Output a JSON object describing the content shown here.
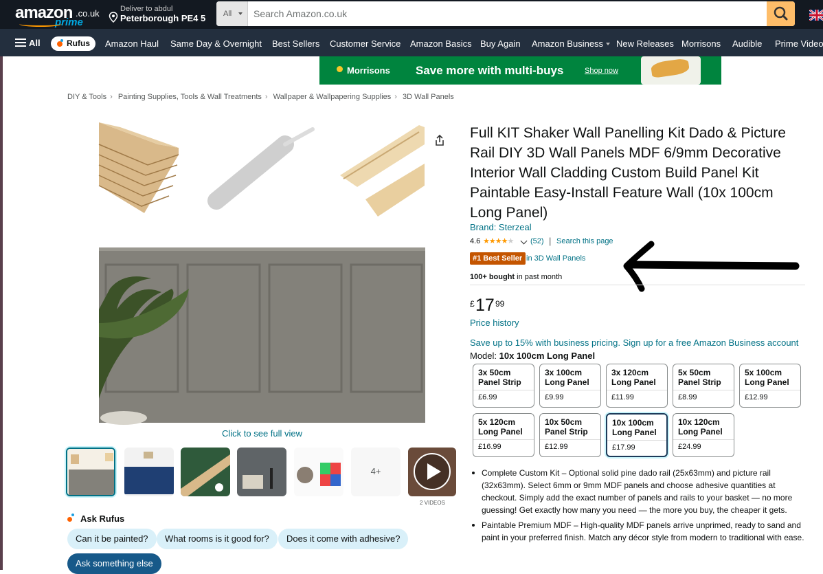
{
  "header": {
    "logo_text": "amazon",
    "logo_cc": ".co.uk",
    "logo_prime": "prime",
    "deliver_line1": "Deliver to abdul",
    "deliver_line2": "Peterborough PE4 5",
    "search_category": "All",
    "search_placeholder": "Search Amazon.co.uk"
  },
  "nav": {
    "all_label": "All",
    "rufus_label": "Rufus",
    "links": [
      "Amazon Haul",
      "Same Day & Overnight",
      "Best Sellers",
      "Customer Service",
      "Amazon Basics",
      "Buy Again",
      "Amazon Business",
      "New Releases",
      "Morrisons",
      "Audible",
      "Prime Video"
    ]
  },
  "banner": {
    "brand": "Morrisons",
    "headline": "Save more with multi-buys",
    "cta": "Shop now"
  },
  "breadcrumbs": [
    "DIY & Tools",
    "Painting Supplies, Tools & Wall Treatments",
    "Wallpaper & Wallpapering Supplies",
    "3D Wall Panels"
  ],
  "gallery": {
    "full_view_label": "Click to see full view",
    "more_label": "4+",
    "videos_label": "2 VIDEOS"
  },
  "rufus": {
    "heading": "Ask Rufus",
    "questions": [
      "Can it be painted?",
      "What rooms is it good for?",
      "Does it come with adhesive?"
    ],
    "ask_button": "Ask something else"
  },
  "product": {
    "title": "Full KIT Shaker Wall Panelling Kit Dado & Picture Rail DIY 3D Wall Panels MDF 6/9mm Decorative Interior Wall Cladding Custom Build Panel Kit Paintable Easy-Install Feature Wall (10x 100cm Long Panel)",
    "brand_link": "Brand: Sterzeal",
    "rating_value": "4.6",
    "rating_stars": 4.6,
    "rating_count": "(52)",
    "search_page": "Search this page",
    "best_seller_badge": "#1 Best Seller",
    "best_seller_category": "in 3D Wall Panels",
    "bought_bold": "100+ bought",
    "bought_rest": " in past month",
    "price_symbol": "£",
    "price_whole": "17",
    "price_fraction": "99",
    "price_history": "Price history",
    "business_line": "Save up to 15% with business pricing. Sign up for a free Amazon Business account",
    "model_label": "Model: ",
    "model_value": "10x 100cm Long Panel"
  },
  "options": [
    {
      "line1": "3x 50cm",
      "line2": "Panel Strip",
      "price": "£6.99"
    },
    {
      "line1": "3x 100cm",
      "line2": "Long Panel",
      "price": "£9.99"
    },
    {
      "line1": "3x 120cm",
      "line2": "Long Panel",
      "price": "£11.99"
    },
    {
      "line1": "5x 50cm",
      "line2": "Panel Strip",
      "price": "£8.99"
    },
    {
      "line1": "5x 100cm",
      "line2": "Long Panel",
      "price": "£12.99"
    },
    {
      "line1": "5x 120cm",
      "line2": "Long Panel",
      "price": "£16.99"
    },
    {
      "line1": "10x 50cm",
      "line2": "Panel Strip",
      "price": "£12.99"
    },
    {
      "line1": "10x 100cm",
      "line2": "Long Panel",
      "price": "£17.99",
      "selected": true
    },
    {
      "line1": "10x 120cm",
      "line2": "Long Panel",
      "price": "£24.99"
    }
  ],
  "bullets": [
    "Complete Custom Kit – Optional solid pine dado rail (25x63mm) and picture rail (32x63mm). Select 6mm or 9mm MDF panels and choose adhesive quantities at checkout. Simply add the exact number of panels and rails to your basket — no more guessing! Get exactly how many you need — the more you buy, the cheaper it gets.",
    "Paintable Premium MDF – High-quality MDF panels arrive unprimed, ready to sand and paint in your preferred finish. Match any décor style from modern to traditional with ease."
  ],
  "colors": {
    "topbar": "#131921",
    "navbar": "#232f3e",
    "search_button": "#febd69",
    "link": "#007185",
    "best_seller": "#c45500",
    "banner": "#00843e",
    "stars": "#ff9900"
  },
  "icons": [
    "location-pin-icon",
    "search-icon",
    "uk-flag-icon",
    "hamburger-icon",
    "share-icon",
    "play-icon",
    "chevron-down-icon",
    "sparkle-icon"
  ]
}
